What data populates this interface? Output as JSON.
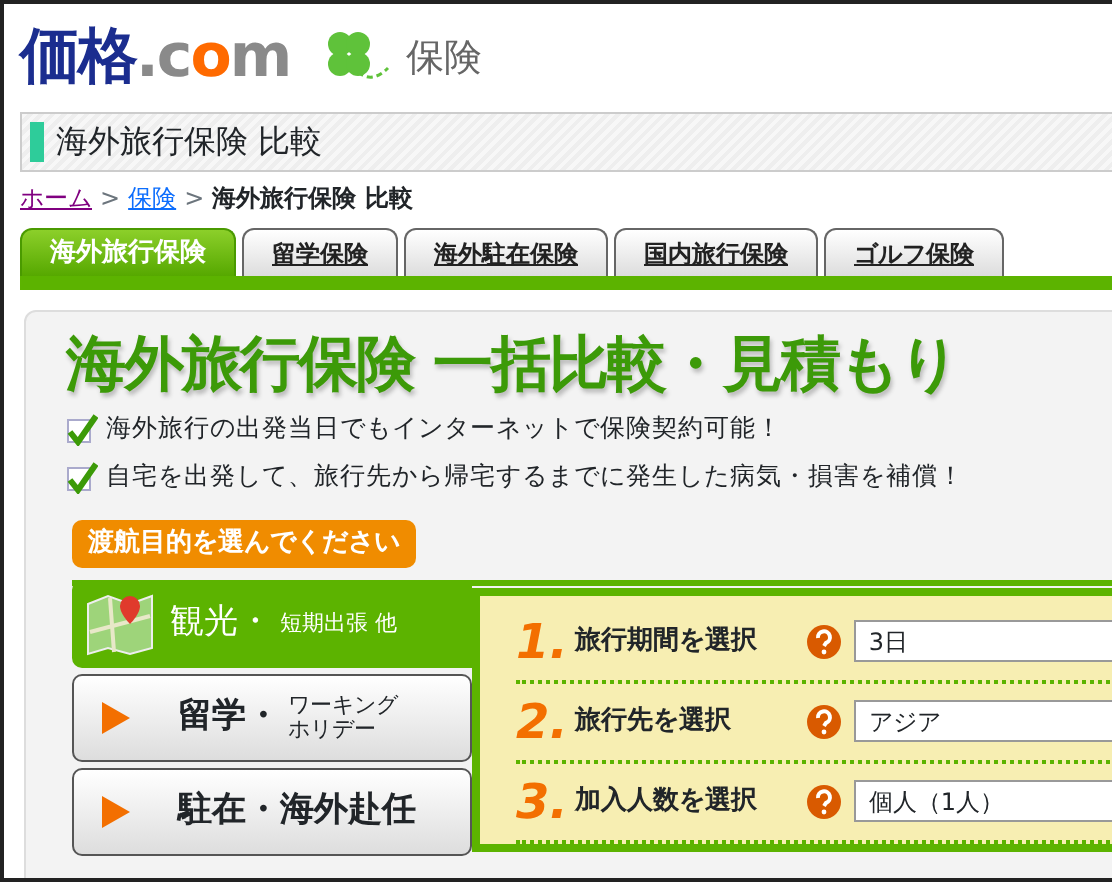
{
  "logo": [
    {
      "text": "価格",
      "color": "#1b2d8f"
    },
    {
      "text": ".c",
      "color": "#8a8a8a"
    },
    {
      "text": "o",
      "color": "#ff6a00"
    },
    {
      "text": "m",
      "color": "#8a8a8a"
    }
  ],
  "section_label": "保険",
  "page_title": "海外旅行保険 比較",
  "breadcrumb": [
    {
      "text": "ホーム",
      "kind": "visited"
    },
    {
      "text": ">",
      "kind": "sep"
    },
    {
      "text": "保険",
      "kind": "link"
    },
    {
      "text": ">",
      "kind": "sep"
    },
    {
      "text": "海外旅行保険 比較",
      "kind": "current"
    }
  ],
  "tabs": [
    {
      "label": "海外旅行保険",
      "selected": true
    },
    {
      "label": "留学保険",
      "selected": false
    },
    {
      "label": "海外駐在保険",
      "selected": false
    },
    {
      "label": "国内旅行保険",
      "selected": false
    },
    {
      "label": "ゴルフ保険",
      "selected": false
    }
  ],
  "headline": "海外旅行保険 一括比較・見積もり",
  "features": [
    {
      "text": "海外旅行の出発当日でもインターネットで保険契約可能！",
      "checked": true
    },
    {
      "text": "自宅を出発して、旅行先から帰宅するまでに発生した病気・損害を補償！",
      "checked": true
    }
  ],
  "purpose_prompt": "渡航目的を選んでください",
  "purposes": [
    {
      "main": "観光・",
      "sub": "短期出張 他",
      "selected": true
    },
    {
      "main": "留学・",
      "sub": "ワーキングホリデー",
      "selected": false
    },
    {
      "main": "駐在・海外赴任",
      "selected": false
    }
  ],
  "steps": [
    {
      "number": "1.",
      "label": "旅行期間を選択",
      "value": "3日"
    },
    {
      "number": "2.",
      "label": "旅行先を選択",
      "value": "アジア"
    },
    {
      "number": "3.",
      "label": "加入人数を選択",
      "value": "個人（1人）"
    }
  ]
}
